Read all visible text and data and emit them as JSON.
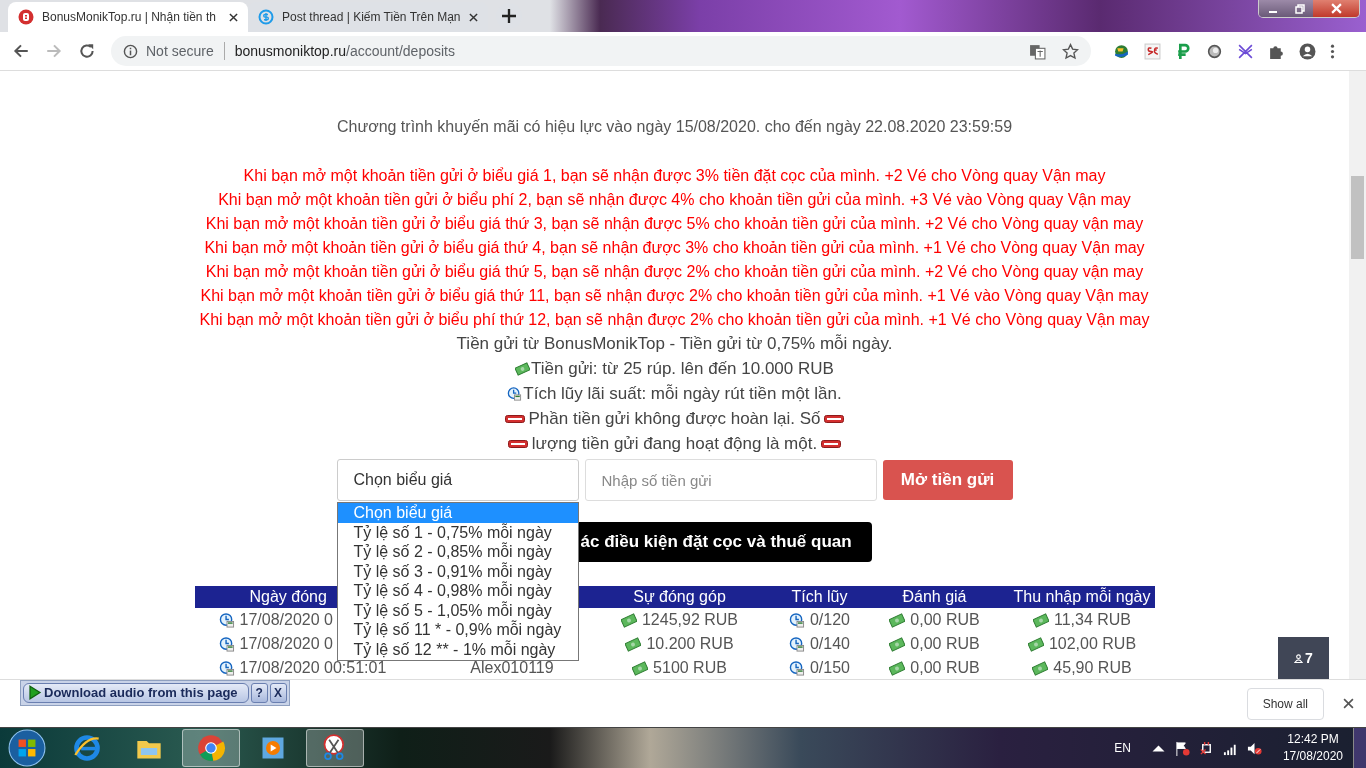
{
  "browser": {
    "tabs": [
      {
        "title": "BonusMonikTop.ru | Nhận tiền th",
        "selected": true
      },
      {
        "title": "Post thread | Kiếm Tiền Trên Mạn",
        "selected": false
      }
    ],
    "security": "Not secure",
    "url_domain": "bonusmoniktop.ru",
    "url_path": "/account/deposits"
  },
  "page": {
    "promo_period": "Chương trình khuyến mãi có hiệu lực vào ngày 15/08/2020. cho đến ngày 22.08.2020 23:59:59",
    "promo_lines": [
      "Khi bạn mở một khoản tiền gửi ở biểu giá 1, bạn sẽ nhận được 3% tiền đặt cọc của mình. +2 Vé cho Vòng quay Vận may",
      "Khi bạn mở một khoản tiền gửi ở biểu phí 2, bạn sẽ nhận được 4% cho khoản tiền gửi của mình. +3 Vé vào Vòng quay Vận may",
      "Khi bạn mở một khoản tiền gửi ở biểu giá thứ 3, bạn sẽ nhận được 5% cho khoản tiền gửi của mình. +2 Vé cho Vòng quay vận may",
      "Khi bạn mở một khoản tiền gửi ở biểu giá thứ 4, bạn sẽ nhận được 3% cho khoản tiền gửi của mình. +1 Vé cho Vòng quay Vận may",
      "Khi bạn mở một khoản tiền gửi ở biểu giá thứ 5, bạn sẽ nhận được 2% cho khoản tiền gửi của mình. +2 Vé cho Vòng quay vận may",
      "Khi bạn mở một khoản tiền gửi ở biểu giá thứ 11, bạn sẽ nhận được 2% cho khoản tiền gửi của mình. +1 Vé vào Vòng quay Vận may",
      "Khi bạn mở một khoản tiền gửi ở biểu phí thứ 12, bạn sẽ nhận được 2% cho khoản tiền gửi của mình. +1 Vé cho Vòng quay Vận may"
    ],
    "info_title": "Tiền gửi từ BonusMonikTop - Tiền gửi từ 0,75% mỗi ngày.",
    "info_lines": [
      {
        "kind": "money",
        "text": "Tiền gửi: từ 25 rúp. lên đến 10.000 RUB"
      },
      {
        "kind": "clock",
        "text": "Tích lũy lãi suất: mỗi ngày rút tiền một lần."
      },
      {
        "kind": "warning",
        "text": "Phần tiền gửi không được hoàn lại. Số"
      },
      {
        "kind": "warning",
        "text": "lượng tiền gửi đang hoạt động là một."
      }
    ],
    "plan_select": {
      "value": "Chọn biểu giá",
      "expanded": true,
      "options": [
        {
          "label": "Chọn biểu giá",
          "selected": true
        },
        {
          "label": "Tỷ lệ số 1 - 0,75% mỗi ngày",
          "selected": false
        },
        {
          "label": "Tỷ lệ số 2 - 0,85% mỗi ngày",
          "selected": false
        },
        {
          "label": "Tỷ lệ số 3 - 0,91% mỗi ngày",
          "selected": false
        },
        {
          "label": "Tỷ lệ số 4 - 0,98% mỗi ngày",
          "selected": false
        },
        {
          "label": "Tỷ lệ số 5 - 1,05% mỗi ngày",
          "selected": false
        },
        {
          "label": "Tỷ lệ số 11 * - 0,9% mỗi ngày",
          "selected": false
        },
        {
          "label": "Tỷ lệ số 12 ** - 1% mỗi ngày",
          "selected": false
        }
      ]
    },
    "amount_field": {
      "placeholder": "Nhập số tiền gửi"
    },
    "open_button": "Mở tiền gửi",
    "conditions_button": "ác điều kiện đặt cọc và thuế quan",
    "table": {
      "columns": [
        "Ngày đóng",
        "Sự đóng góp",
        "Tích lũy",
        "Đánh giá",
        "Thu nhập mỗi ngày"
      ],
      "rows": [
        {
          "date": "17/08/2020 0",
          "amount": "1245,92 RUB",
          "accrual": "0/120",
          "rating": "0,00 RUB",
          "daily": "11,34 RUB"
        },
        {
          "date": "17/08/2020 0",
          "amount": "10.200 RUB",
          "accrual": "0/140",
          "rating": "0,00 RUB",
          "daily": "102,00 RUB"
        },
        {
          "date": "17/08/2020 00:51:01",
          "login": "Alex010119",
          "amount": "5100 RUB",
          "accrual": "0/150",
          "rating": "0,00 RUB",
          "daily": "45,90 RUB"
        }
      ]
    },
    "online_badge": "7"
  },
  "download_bar": {
    "extension_button": "Download audio from this page",
    "help": "?",
    "close": "X",
    "show_all": "Show all"
  },
  "taskbar": {
    "apps": [
      {
        "kind": "ie",
        "active": false
      },
      {
        "kind": "folder",
        "active": false
      },
      {
        "kind": "chrome",
        "active": true
      },
      {
        "kind": "media",
        "active": false
      },
      {
        "kind": "snip",
        "active": true
      }
    ],
    "language": "EN",
    "time": "12:42 PM",
    "date": "17/08/2020"
  }
}
